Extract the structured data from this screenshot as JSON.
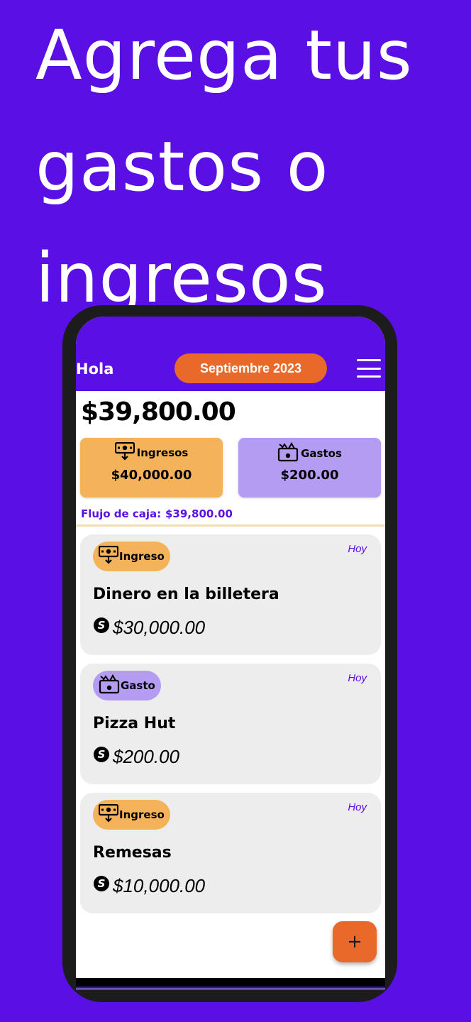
{
  "hero": {
    "line1": "Agrega tus",
    "line2": "gastos o",
    "line3": "ingresos"
  },
  "app": {
    "greeting": "Hola",
    "month_button": "Septiembre 2023",
    "balance": "$39,800.00",
    "income_card": {
      "label": "Ingresos",
      "value": "$40,000.00",
      "icon": "cash-in-icon"
    },
    "expense_card": {
      "label": "Gastos",
      "value": "$200.00",
      "icon": "cash-out-icon"
    },
    "cashflow": {
      "label": "Flujo de caja:",
      "value": "$39,800.00"
    },
    "transactions": [
      {
        "type": "Ingreso",
        "date": "Hoy",
        "title": "Dinero en la billetera",
        "amount": "$30,000.00",
        "icon": "cash-in-icon"
      },
      {
        "type": "Gasto",
        "date": "Hoy",
        "title": "Pizza Hut",
        "amount": "$200.00",
        "icon": "cash-out-icon"
      },
      {
        "type": "Ingreso",
        "date": "Hoy",
        "title": "Remesas",
        "amount": "$10,000.00",
        "icon": "cash-in-icon"
      }
    ],
    "fab_label": "+"
  },
  "colors": {
    "background": "#5a0fe4",
    "accent_orange": "#e8692a",
    "income": "#f4b35b",
    "expense": "#b39cf2",
    "card_bg": "#ededed"
  }
}
